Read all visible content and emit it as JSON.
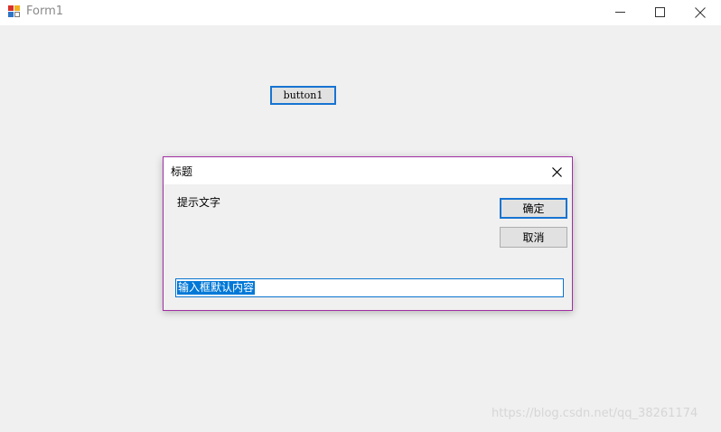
{
  "window": {
    "title": "Form1"
  },
  "main": {
    "button1_label": "button1"
  },
  "dialog": {
    "title": "标题",
    "prompt": "提示文字",
    "ok_label": "确定",
    "cancel_label": "取消",
    "input_value": "输入框默认内容"
  },
  "watermark": "https://blog.csdn.net/qq_38261174",
  "colors": {
    "accent_border": "#1774d2",
    "dialog_border": "#a12fa3",
    "selection": "#0078d7",
    "background": "#f0f0f0"
  }
}
